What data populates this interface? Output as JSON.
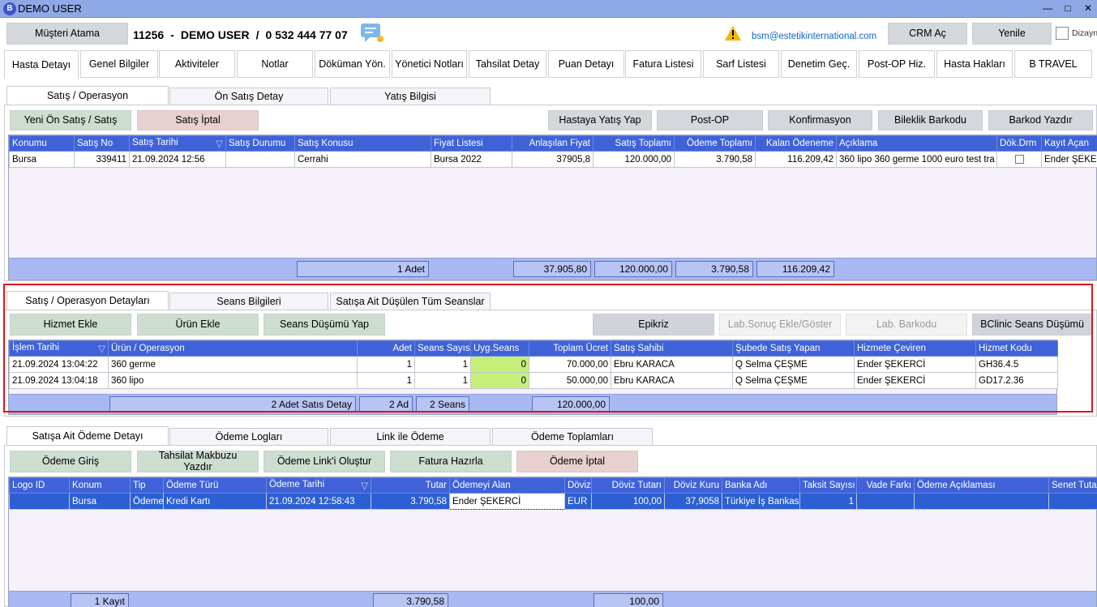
{
  "window": {
    "app_icon": "B",
    "title": "DEMO USER",
    "minimize": "—",
    "maximize": "□",
    "close": "✕"
  },
  "topbar": {
    "musteri_atama": "Müşteri Atama",
    "patient_id": "11256",
    "sep1": "-",
    "patient_name": "DEMO USER",
    "sep2": "/",
    "phone": "0 532 444 77 07",
    "email": "bsm@estetikinternational.com",
    "crm": "CRM Aç",
    "yenile": "Yenile",
    "dizayn": "Dizayn"
  },
  "main_tabs": [
    "Hasta Detayı",
    "Genel Bilgiler",
    "Aktiviteler",
    "Notlar",
    "Döküman Yön.",
    "Yönetici Notları",
    "Tahsilat Detay",
    "Puan Detayı",
    "Fatura Listesi",
    "Sarf Listesi",
    "Denetim Geç.",
    "Post-OP Hiz.",
    "Hasta Hakları",
    "B TRAVEL"
  ],
  "sec1": {
    "tabs": [
      "Satış / Operasyon",
      "Ön Satış Detay",
      "Yatış Bilgisi"
    ],
    "buttons": {
      "yeni": "Yeni Ön Satış / Satış",
      "iptal": "Satış İptal",
      "yatis": "Hastaya Yatış Yap",
      "postop": "Post-OP",
      "konf": "Konfirmasyon",
      "bileklik": "Bileklik Barkodu",
      "barkod": "Barkod Yazdır"
    },
    "columns": [
      "Konumu",
      "Satış No",
      "Satış Tarihi",
      "Satış Durumu",
      "Satış Konusu",
      "Fiyat Listesi",
      "Anlaşılan Fiyat",
      "Satış Toplamı",
      "Ödeme Toplamı",
      "Kalan Ödeneme",
      "Açıklama",
      "Dök.Drm",
      "Kayıt Açan"
    ],
    "rows": [
      [
        "Bursa",
        "339411",
        "21.09.2024 12:56",
        "",
        "Cerrahi",
        "Bursa 2022",
        "37905,8",
        "120.000,00",
        "3.790,58",
        "116.209,42",
        "360 lipo 360 germe 1000 euro test tra",
        "",
        "Ender ŞEKERCİ"
      ]
    ],
    "footer": {
      "adet": "1 Adet",
      "anlasilan": "37.905,80",
      "satis": "120.000,00",
      "odeme": "3.790,58",
      "kalan": "116.209,42"
    }
  },
  "sec2": {
    "tabs": [
      "Satış / Operasyon Detayları",
      "Seans Bilgileri",
      "Satışa Ait Düşülen Tüm Seanslar"
    ],
    "buttons": {
      "hizmet": "Hizmet Ekle",
      "urun": "Ürün Ekle",
      "seans": "Seans Düşümü Yap",
      "epikriz": "Epikriz",
      "lab": "Lab.Sonuç Ekle/Göster",
      "labbarkod": "Lab. Barkodu",
      "bclinic": "BClinic Seans Düşümü"
    },
    "columns": [
      "İşlem Tarihi",
      "Ürün / Operasyon",
      "Adet",
      "Seans Sayısı",
      "Uyg.Seans",
      "Toplam Ücret",
      "Satış Sahibi",
      "Şubede Satış Yapan",
      "Hizmete Çeviren",
      "Hizmet Kodu"
    ],
    "rows": [
      [
        "21.09.2024 13:04:22",
        "360 germe",
        "1",
        "1",
        "0",
        "70.000,00",
        "Ebru KARACA",
        "Q Selma ÇEŞME",
        "Ender ŞEKERCİ",
        "GH36.4.5"
      ],
      [
        "21.09.2024 13:04:18",
        "360 lipo",
        "1",
        "1",
        "0",
        "50.000,00",
        "Ebru KARACA",
        "Q Selma ÇEŞME",
        "Ender ŞEKERCİ",
        "GD17.2.36"
      ]
    ],
    "footer": {
      "detay": "2 Adet Satıs Detay",
      "ad": "2 Ad",
      "seans": "2 Seans",
      "toplam": "120.000,00"
    }
  },
  "sec3": {
    "tabs": [
      "Satışa Ait Ödeme Detayı",
      "Ödeme Logları",
      "Link ile Ödeme",
      "Ödeme Toplamları"
    ],
    "buttons": {
      "giris": "Ödeme Giriş",
      "makbuz": "Tahsilat Makbuzu Yazdır",
      "link": "Ödeme Link'i Oluştur",
      "fatura": "Fatura Hazırla",
      "iptal": "Ödeme İptal"
    },
    "columns": [
      "Logo ID",
      "Konum",
      "Tip",
      "Ödeme Türü",
      "Ödeme Tarihi",
      "Tutar",
      "Ödemeyi Alan",
      "Döviz",
      "Döviz Tutarı",
      "Döviz Kuru",
      "Banka Adı",
      "Taksit Sayısı",
      "Vade Farkı",
      "Ödeme Açıklaması",
      "Senet Tutarı"
    ],
    "rows": [
      [
        "",
        "Bursa",
        "Ödeme",
        "Kredi Kartı",
        "21.09.2024 12:58:43",
        "3.790,58",
        "Ender ŞEKERCİ",
        "EUR",
        "100,00",
        "37,9058",
        "Türkiye İş Bankası",
        "1",
        "",
        "",
        ""
      ]
    ],
    "footer": {
      "kayit": "1 Kayıt",
      "tutar": "3.790,58",
      "doviz": "100,00"
    }
  },
  "colors": {
    "header_blue": "#3f62d8",
    "title_blue": "#8fa8e6",
    "highlight_red": "#e0141b",
    "green_cell": "#c4f07a",
    "selected_row": "#2b5fd3"
  },
  "icons": [
    "chat-icon",
    "warning-icon",
    "sort-icon"
  ]
}
